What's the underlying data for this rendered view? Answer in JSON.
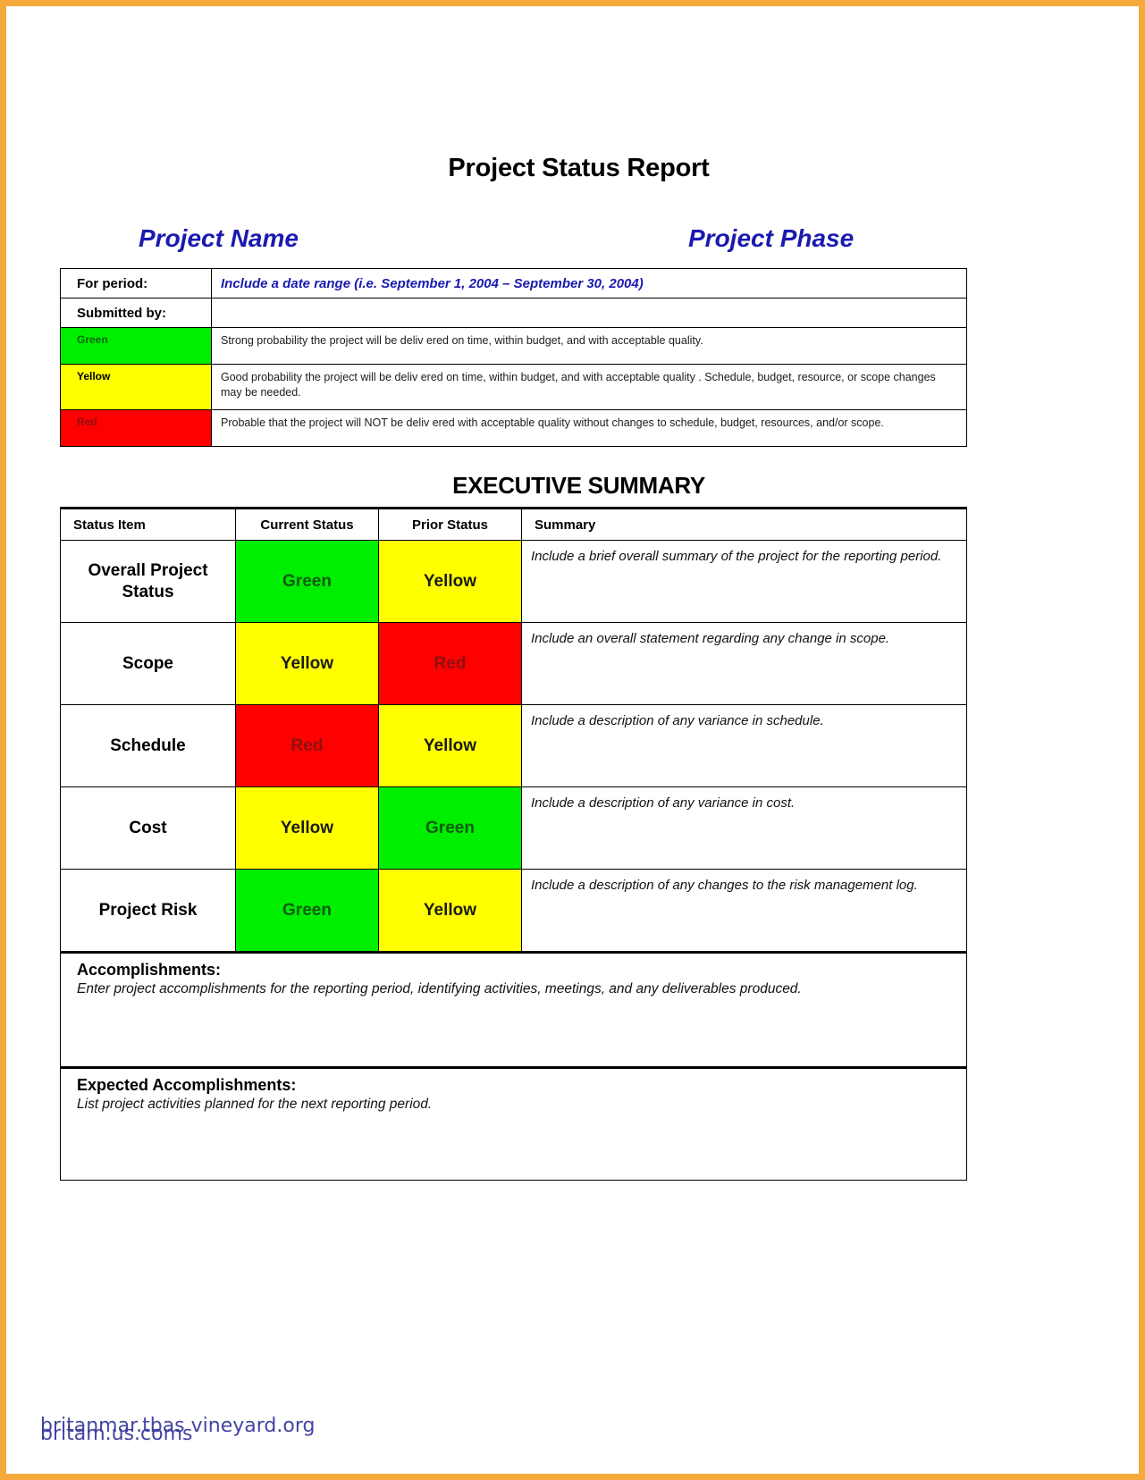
{
  "document": {
    "title": "Project Status Report",
    "project_name_heading": "Project Name",
    "project_phase_heading": "Project Phase"
  },
  "info": {
    "for_period_label": "For period:",
    "for_period_value": "Include a date range (i.e. September 1, 2004 – September 30, 2004)",
    "submitted_by_label": "Submitted by:",
    "submitted_by_value": "",
    "legend": [
      {
        "level": "Green",
        "color": "#00ee00",
        "description": "Strong probability  the project will be deliv ered on time, within budget, and with acceptable quality."
      },
      {
        "level": "Yellow",
        "color": "#ffff00",
        "description": "Good probability the project will be deliv ered on time, within budget, and with acceptable quality . Schedule, budget, resource, or scope changes may be needed."
      },
      {
        "level": "Red",
        "color": "#ff0000",
        "description": "Probable that the project will NOT be deliv ered with acceptable quality without changes to schedule, budget, resources, and/or scope."
      }
    ]
  },
  "executive_summary": {
    "heading": "EXECUTIVE SUMMARY",
    "columns": [
      "Status Item",
      "Current Status",
      "Prior Status",
      "Summary"
    ],
    "rows": [
      {
        "item": "Overall Project Status",
        "current_status": "Green",
        "current_color": "#00ee00",
        "prior_status": "Yellow",
        "prior_color": "#ffff00",
        "summary": "Include a brief overall summary of the project for the reporting period."
      },
      {
        "item": "Scope",
        "current_status": "Yellow",
        "current_color": "#ffff00",
        "prior_status": "Red",
        "prior_color": "#ff0000",
        "summary": "Include an overall statement regarding any change in scope."
      },
      {
        "item": "Schedule",
        "current_status": "Red",
        "current_color": "#ff0000",
        "prior_status": "Yellow",
        "prior_color": "#ffff00",
        "summary": "Include a description of any variance in schedule."
      },
      {
        "item": "Cost",
        "current_status": "Yellow",
        "current_color": "#ffff00",
        "prior_status": "Green",
        "prior_color": "#00ee00",
        "summary": "Include a description of any variance in cost."
      },
      {
        "item": "Project Risk",
        "current_status": "Green",
        "current_color": "#00ee00",
        "prior_status": "Yellow",
        "prior_color": "#ffff00",
        "summary": "Include a description of any changes to the risk management log."
      }
    ]
  },
  "accomplishments": {
    "title": "Accomplishments:",
    "text": "Enter project accomplishments for the reporting period, identifying activities, meetings, and any deliverables produced."
  },
  "expected_accomplishments": {
    "title": "Expected Accomplishments:",
    "text": "List project activities planned for the next reporting period."
  },
  "footer": {
    "watermark_1": "britanmar.tbas vineyard.org",
    "watermark_2": "britam.us.coms"
  }
}
